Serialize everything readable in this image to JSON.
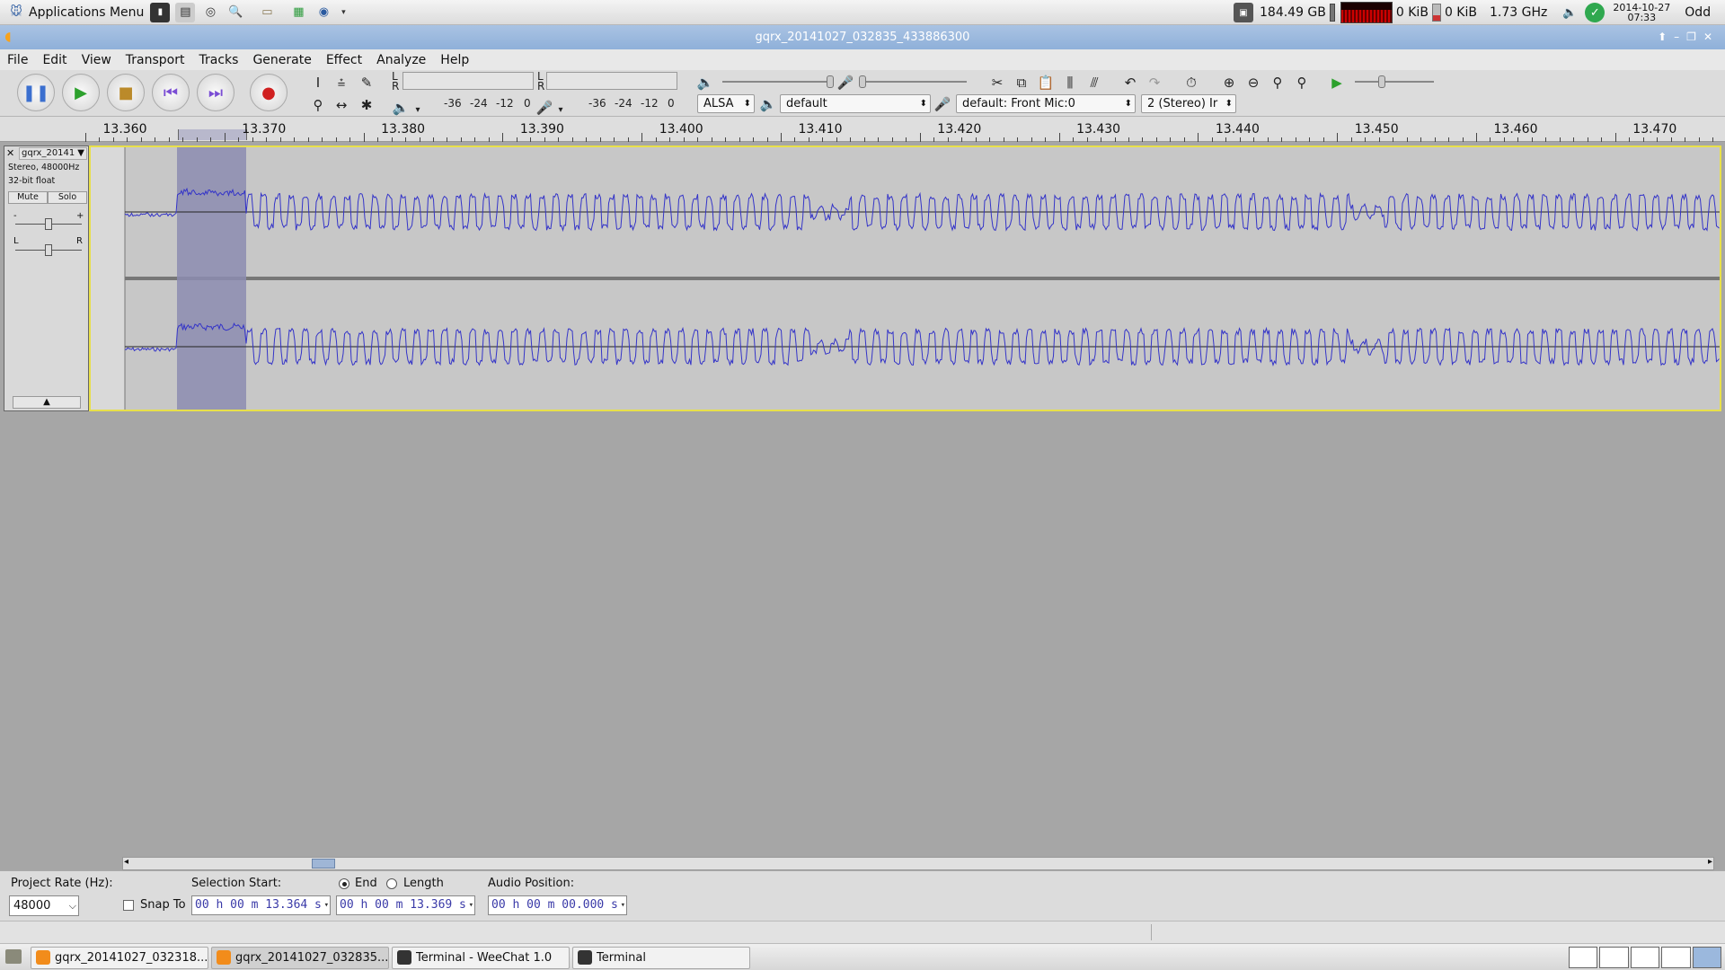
{
  "top_panel": {
    "app_menu": "Applications Menu",
    "disk_free": "184.49 GB",
    "net_down": "0 KiB",
    "net_up": "0 KiB",
    "cpu_freq": "1.73 GHz",
    "date": "2014-10-27",
    "time": "07:33",
    "weekday_tag": "Odd"
  },
  "window": {
    "title": "gqrx_20141027_032835_433886300"
  },
  "menus": [
    "File",
    "Edit",
    "View",
    "Transport",
    "Tracks",
    "Generate",
    "Effect",
    "Analyze",
    "Help"
  ],
  "meters": {
    "ticks_play": [
      "-36",
      "-24",
      "-12",
      "0"
    ],
    "ticks_rec": [
      "-36",
      "-24",
      "-12",
      "0"
    ],
    "ch_l": "L",
    "ch_r": "R"
  },
  "device": {
    "host": "ALSA",
    "output": "default",
    "input": "default: Front Mic:0",
    "channels": "2 (Stereo) Ir"
  },
  "ruler": {
    "ticks": [
      "13.360",
      "13.370",
      "13.380",
      "13.390",
      "13.400",
      "13.410",
      "13.420",
      "13.430",
      "13.440",
      "13.450",
      "13.460",
      "13.470"
    ]
  },
  "track": {
    "name": "gqrx_20141",
    "info1": "Stereo, 48000Hz",
    "info2": "32-bit float",
    "mute": "Mute",
    "solo": "Solo",
    "gain_minus": "-",
    "gain_plus": "+",
    "pan_l": "L",
    "pan_r": "R",
    "y_labels": [
      "1.0",
      "0.5",
      "0.0-",
      "-0.5",
      "-1.0"
    ]
  },
  "selection_bar": {
    "rate_label": "Project Rate (Hz):",
    "rate_value": "48000",
    "snap_label": "Snap To",
    "sel_start_label": "Selection Start:",
    "end_label": "End",
    "length_label": "Length",
    "audio_pos_label": "Audio Position:",
    "sel_start": "00 h 00 m 13.364 s",
    "sel_end": "00 h 00 m 13.369 s",
    "audio_pos": "00 h 00 m 00.000 s",
    "end_selected": true
  },
  "taskbar": {
    "tasks": [
      "gqrx_20141027_032318...",
      "gqrx_20141027_032835...",
      "Terminal - WeeChat 1.0",
      "Terminal"
    ]
  },
  "colors": {
    "waveform": "#3434c8",
    "selection": "#8c8cb0",
    "track_border": "#e8e04a",
    "titlebar": "#9bb8dd"
  }
}
